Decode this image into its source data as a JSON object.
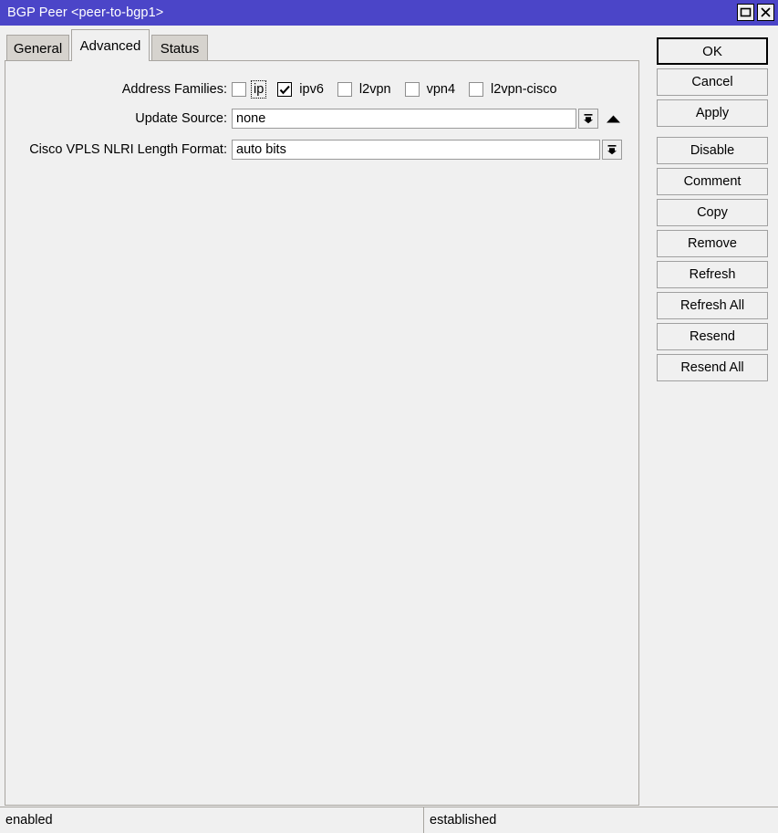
{
  "window": {
    "title": "BGP Peer <peer-to-bgp1>",
    "controls": [
      {
        "name": "maximize-button",
        "icon": "maximize-icon"
      },
      {
        "name": "close-button",
        "icon": "close-icon"
      }
    ]
  },
  "tabs": [
    {
      "label": "General",
      "active": false
    },
    {
      "label": "Advanced",
      "active": true
    },
    {
      "label": "Status",
      "active": false
    }
  ],
  "form": {
    "address_families": {
      "label": "Address Families:",
      "options": [
        {
          "label": "ip",
          "checked": false,
          "focused": true
        },
        {
          "label": "ipv6",
          "checked": true,
          "focused": false
        },
        {
          "label": "l2vpn",
          "checked": false,
          "focused": false
        },
        {
          "label": "vpn4",
          "checked": false,
          "focused": false
        },
        {
          "label": "l2vpn-cisco",
          "checked": false,
          "focused": false
        }
      ]
    },
    "update_source": {
      "label": "Update Source:",
      "value": "none",
      "dropdown_icon": "dropdown-arrow-icon",
      "extra_icon": "up-triangle-icon"
    },
    "cisco_vpls_nlri": {
      "label": "Cisco VPLS NLRI Length Format:",
      "value": "auto bits",
      "dropdown_icon": "dropdown-arrow-icon"
    }
  },
  "buttons": [
    {
      "label": "OK",
      "default": true,
      "spaced": false
    },
    {
      "label": "Cancel",
      "default": false,
      "spaced": false
    },
    {
      "label": "Apply",
      "default": false,
      "spaced": false
    },
    {
      "label": "Disable",
      "default": false,
      "spaced": true
    },
    {
      "label": "Comment",
      "default": false,
      "spaced": false
    },
    {
      "label": "Copy",
      "default": false,
      "spaced": false
    },
    {
      "label": "Remove",
      "default": false,
      "spaced": false
    },
    {
      "label": "Refresh",
      "default": false,
      "spaced": false
    },
    {
      "label": "Refresh All",
      "default": false,
      "spaced": false
    },
    {
      "label": "Resend",
      "default": false,
      "spaced": false
    },
    {
      "label": "Resend All",
      "default": false,
      "spaced": false
    }
  ],
  "statusbar": {
    "left": "enabled",
    "right": "established"
  },
  "colors": {
    "titlebar": "#4b45c8",
    "titlebar_text": "#ffffff",
    "panel_bg": "#f0f0f0",
    "tab_inactive": "#d6d3ce",
    "border": "#a8a5a0",
    "field_bg": "#ffffff"
  }
}
